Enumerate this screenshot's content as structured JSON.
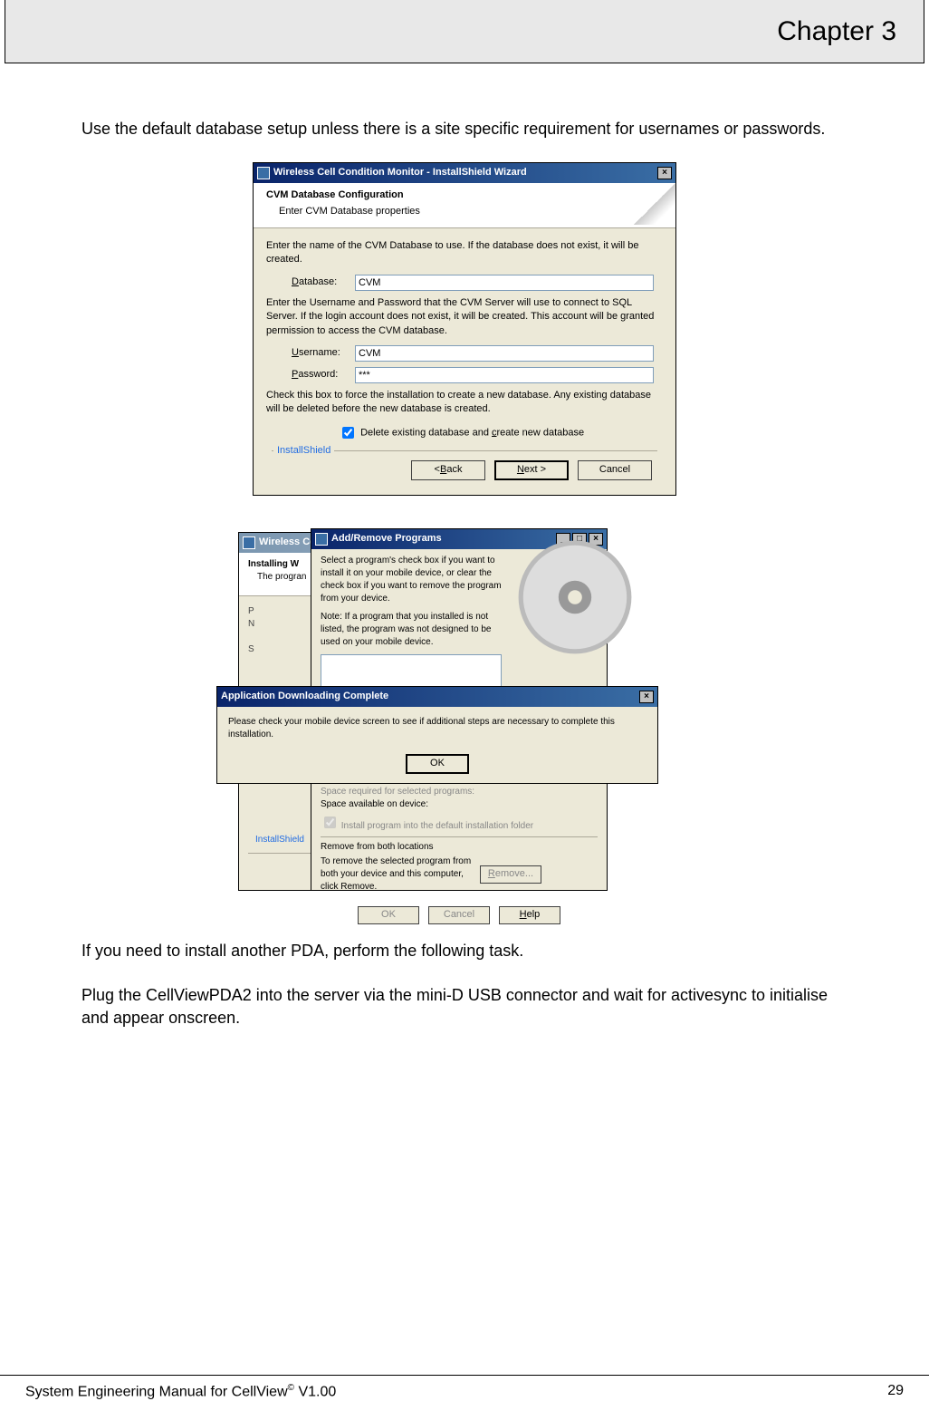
{
  "header": {
    "chapter": "Chapter 3"
  },
  "paragraphs": {
    "p1": "Use the default database setup unless there is a site specific requirement for usernames or passwords.",
    "p2": "If you need to install another PDA, perform the following task.",
    "p3": "Plug the CellViewPDA2 into the server via the mini-D USB connector and wait for activesync to initialise and appear onscreen."
  },
  "dialog1": {
    "title": "Wireless Cell Condition Monitor - InstallShield Wizard",
    "head_title": "CVM Database Configuration",
    "head_sub": "Enter CVM Database properties",
    "text1": "Enter the name of the CVM Database to use.  If the database does not exist, it will be created.",
    "label_db": "Database:",
    "value_db": "CVM",
    "text2": "Enter the Username and Password that the CVM Server will use to connect to SQL Server.  If the login account does not exist, it will be created.  This account will be granted permission to access the CVM database.",
    "label_user": "Username:",
    "value_user": "CVM",
    "label_pass": "Password:",
    "value_pass": "***",
    "text3": "Check this box to force the installation to create a new database.  Any existing database will be deleted before the new database is created.",
    "check_label": "Delete existing database and create new database",
    "legend": "InstallShield",
    "btn_back": "< Back",
    "btn_next": "Next >",
    "btn_cancel": "Cancel"
  },
  "dialog2a": {
    "head1": "Installing W",
    "head2": "The progran",
    "legend": "InstallShield",
    "btn_cancel": "Cancel"
  },
  "dialog2b": {
    "title": "Add/Remove Programs",
    "t1": "Select a program's check box if you want to install it on your mobile device, or clear the check box if you want to remove the program from your device.",
    "t2": "Note:  If a program that you installed is not listed, the program was not designed to be used on your mobile device.",
    "t3": "Space required for selected programs:",
    "t4": "Space available on device:",
    "chk": "Install program into the default installation folder",
    "grp": "Remove from both locations",
    "t5": "To remove the selected program from both your device and this computer, click Remove.",
    "btn_remove": "Remove...",
    "btn_ok": "OK",
    "btn_cancel": "Cancel",
    "btn_help": "Help"
  },
  "dialog2c": {
    "title": "Application Downloading Complete",
    "body": "Please check your mobile device screen to see if additional steps are necessary to complete this installation.",
    "btn_ok": "OK"
  },
  "footer": {
    "left_a": "System Engineering Manual for CellView",
    "left_b": " V1.00",
    "page": "29"
  }
}
